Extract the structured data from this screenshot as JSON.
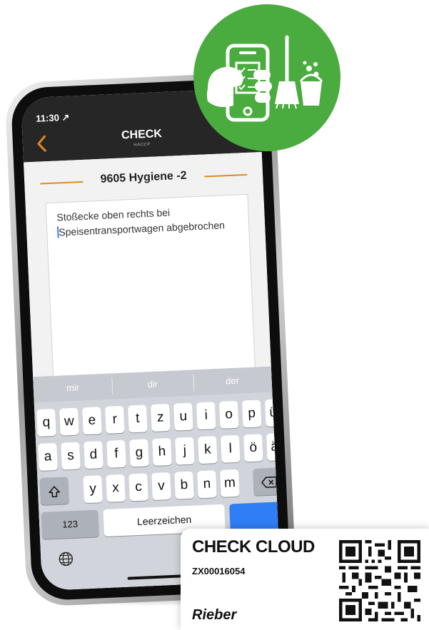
{
  "status_bar": {
    "time": "11:30 ↗"
  },
  "navbar": {
    "title": "CHECK",
    "subtitle": "HACCP"
  },
  "section": {
    "title": "9605 Hygiene -2"
  },
  "note": {
    "text_line1": "Stoßecke oben rechts bei",
    "text_line2": "Speisentransportwagen abgebrochen"
  },
  "keyboard": {
    "suggestions": [
      "mir",
      "dir",
      "der"
    ],
    "row1": [
      "q",
      "w",
      "e",
      "r",
      "t",
      "z",
      "u",
      "i",
      "o",
      "p",
      "ü"
    ],
    "row2": [
      "a",
      "s",
      "d",
      "f",
      "g",
      "h",
      "j",
      "k",
      "l",
      "ö",
      "ä"
    ],
    "row3": [
      "y",
      "x",
      "c",
      "v",
      "b",
      "n",
      "m"
    ],
    "numbers_label": "123",
    "space_label": "Leerzeichen"
  },
  "card": {
    "title": "CHECK CLOUD",
    "code": "ZX00016054",
    "brand": "Rieber"
  },
  "colors": {
    "accent": "#e08a1e",
    "badge_green": "#4aab3f",
    "keyboard_blue": "#2f7ef6"
  },
  "icons": [
    "back-chevron-icon",
    "shift-icon",
    "backspace-icon",
    "globe-icon",
    "phone-checklist-icon",
    "broom-icon",
    "bucket-icon",
    "qr-code"
  ]
}
